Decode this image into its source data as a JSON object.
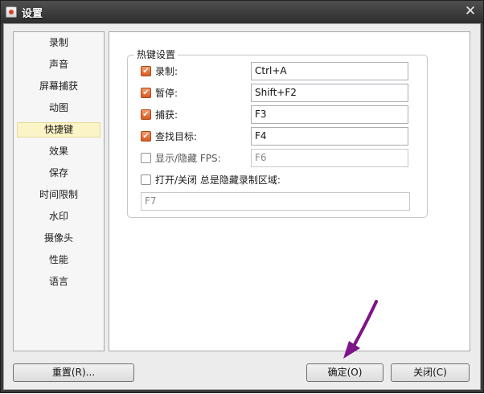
{
  "window": {
    "title": "设置",
    "close_glyph": "✕"
  },
  "sidebar": {
    "selected_index": 4,
    "items": [
      "录制",
      "声音",
      "屏幕捕获",
      "动图",
      "快捷键",
      "效果",
      "保存",
      "时间限制",
      "水印",
      "摄像头",
      "性能",
      "语言"
    ]
  },
  "hotkeys": {
    "group_title": "热键设置",
    "rows": [
      {
        "label": "录制:",
        "checked": true,
        "value": "Ctrl+A"
      },
      {
        "label": "暂停:",
        "checked": true,
        "value": "Shift+F2"
      },
      {
        "label": "捕获:",
        "checked": true,
        "value": "F3"
      },
      {
        "label": "查找目标:",
        "checked": true,
        "value": "F4"
      },
      {
        "label": "显示/隐藏 FPS:",
        "checked": false,
        "value": "F6"
      }
    ],
    "always_hide": {
      "label": "打开/关闭 总是隐藏录制区域:",
      "checked": false,
      "value": "F7"
    }
  },
  "buttons": {
    "reset": "重置(R)...",
    "ok": "确定(O)",
    "close": "关闭(C)"
  },
  "colors": {
    "accent_checkbox": "#e0662f",
    "selected_item_bg": "#fbf4c6",
    "annotation_arrow": "#7d1487"
  }
}
